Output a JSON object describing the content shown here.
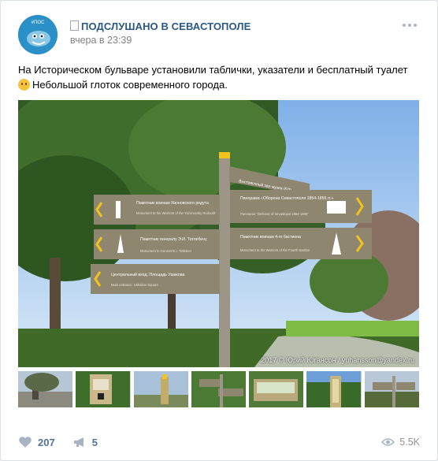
{
  "post": {
    "author": "ПОДСЛУШАНО В СЕВАСТОПОЛЕ",
    "avatar_text": "#ПОС",
    "date": "вчера в 23:39",
    "text_line1": "На Историческом бульваре установили таблички, указатели и бесплатный туалет",
    "text_line2": "Небольшой глоток современного города.",
    "emoji_icon": "slightly-smiling-face-icon"
  },
  "photo": {
    "caption": "2017 © Юрий Югансон / yuhansson@yandex.ru",
    "signs": {
      "top": "Выставочный зал музея (БП)",
      "left1": "Памятник воинам Язоновского редута",
      "left1_en": "Monument to the Warriors of the Yazonovsky Redoubt",
      "left2": "Памятник генералу Э.И. Тотлебену",
      "left2_en": "Monument to General E.I. Totleben",
      "left3": "Центральный вход. Площадь Ушакова",
      "left3_en": "Main entrance. Ushakov Square",
      "right1": "Панорама «Оборона Севастополя 1854-1855 гг.»",
      "right1_en": "Panorama \"Defense of Sevastopol 1854-1855\"",
      "right2": "Памятник воинам 4-го бастиона",
      "right2_en": "Monument to the Warriors of the Fourth Bastion"
    }
  },
  "stats": {
    "likes": "207",
    "reposts": "5",
    "views": "5.5K"
  },
  "colors": {
    "link": "#2a5885",
    "action": "#51739c",
    "sign": "#8f8670",
    "arrow": "#f2c21b"
  }
}
